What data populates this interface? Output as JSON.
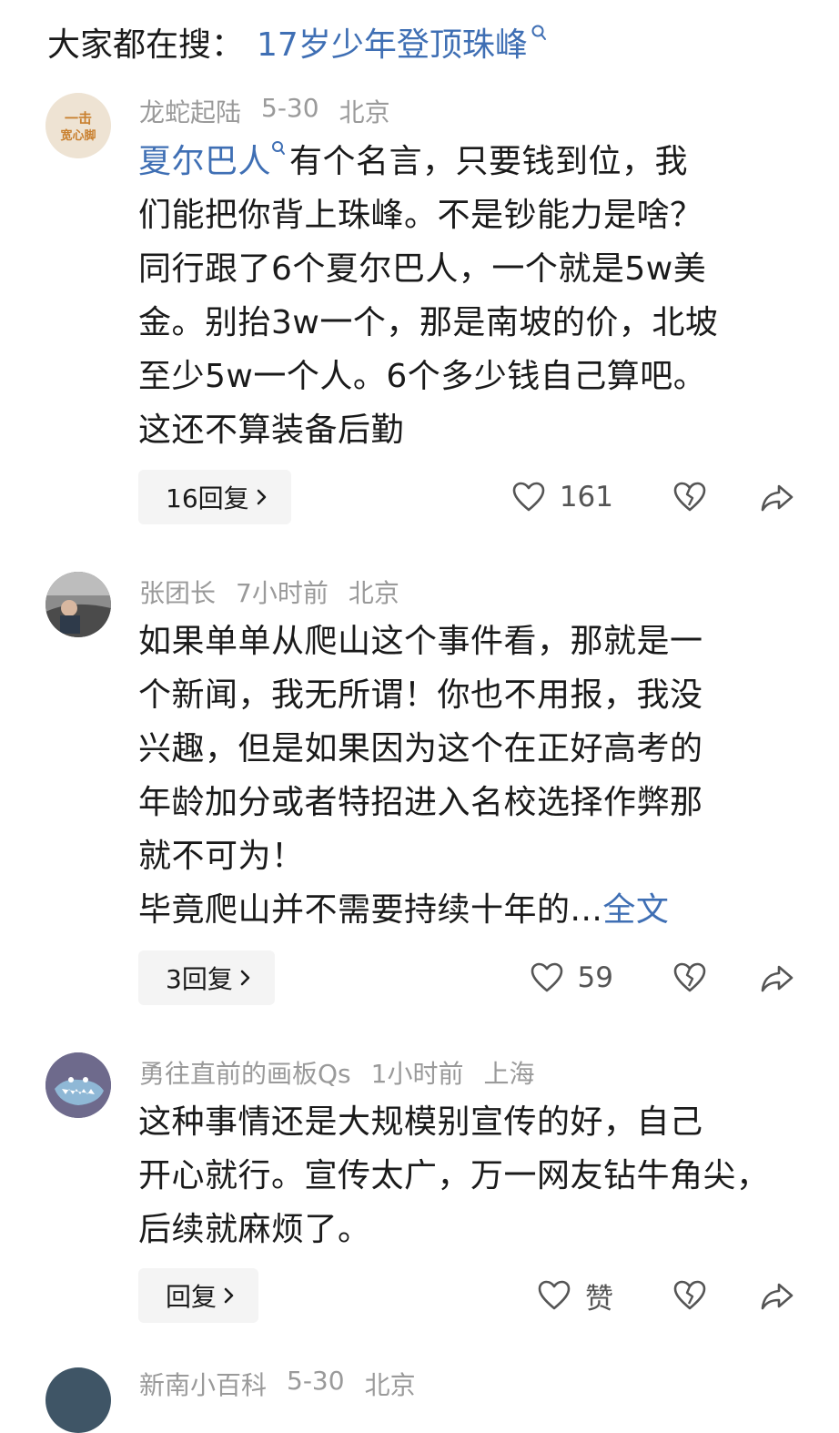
{
  "search": {
    "prefix": "大家都在搜：",
    "term": "17岁少年登顶珠峰"
  },
  "comments": [
    {
      "username": "龙蛇起陆",
      "time": "5-30",
      "location": "北京",
      "avatar_text": "一击\n宽心脚",
      "tag": "夏尔巴人",
      "lines": [
        "有个名言，只要钱到位，我",
        "们能把你背上珠峰。不是钞能力是啥？",
        "同行跟了6个夏尔巴人，一个就是5w美",
        "金。别抬3w一个，那是南坡的价，北坡",
        "至少5w一个人。6个多少钱自己算吧。",
        "这还不算装备后勤"
      ],
      "replies": "16回复",
      "likes": "161"
    },
    {
      "username": "张团长",
      "time": "7小时前",
      "location": "北京",
      "lines": [
        "如果单单从爬山这个事件看，那就是一",
        "个新闻，我无所谓！你也不用报，我没",
        "兴趣，但是如果因为这个在正好高考的",
        "年龄加分或者特招进入名校选择作弊那",
        "就不可为！",
        "毕竟爬山并不需要持续十年的..."
      ],
      "more_link": "全文",
      "replies": "3回复",
      "likes": "59"
    },
    {
      "username": "勇往直前的画板Qs",
      "time": "1小时前",
      "location": "上海",
      "lines": [
        "这种事情还是大规模别宣传的好，自己",
        "开心就行。宣传太广，万一网友钻牛角尖，",
        "后续就麻烦了。"
      ],
      "replies": "回复",
      "likes": "赞"
    },
    {
      "username": "新南小百科",
      "time": "5-30",
      "location": "北京"
    }
  ],
  "colors": {
    "link": "#3f6fb4",
    "meta": "#9a9a9a",
    "pill_bg": "#f4f4f4"
  }
}
